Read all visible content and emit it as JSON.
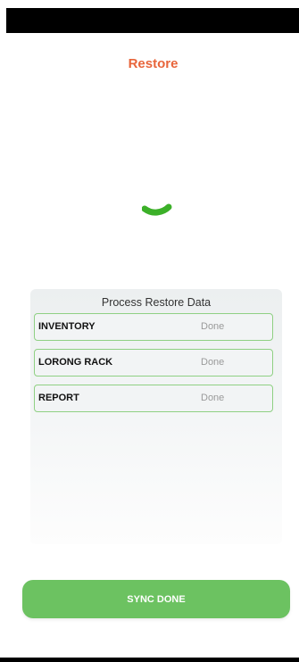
{
  "header": {
    "title": "Restore"
  },
  "loader": {
    "icon": "spinner-icon",
    "color": "#3cb029"
  },
  "process": {
    "title": "Process Restore Data",
    "rows": [
      {
        "name": "INVENTORY",
        "status": "Done"
      },
      {
        "name": "LORONG RACK",
        "status": "Done"
      },
      {
        "name": "REPORT",
        "status": "Done"
      }
    ]
  },
  "footer": {
    "button_label": "SYNC DONE"
  },
  "colors": {
    "accent": "#e8653b",
    "success": "#6cc261",
    "row_border": "#8fd083"
  }
}
